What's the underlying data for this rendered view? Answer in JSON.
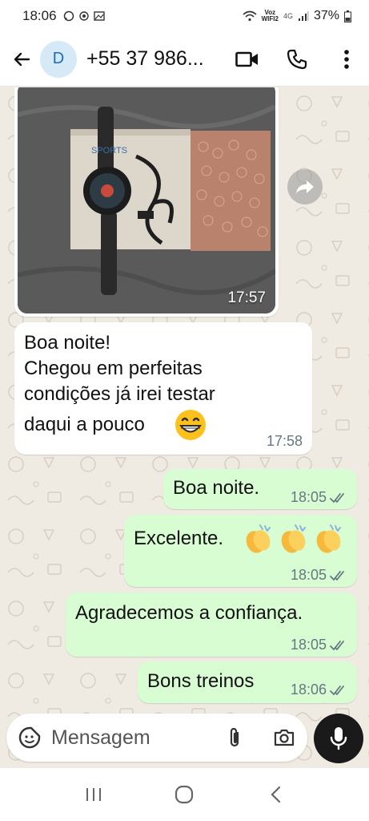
{
  "status_bar": {
    "time": "18:06",
    "voz_label": "Voz",
    "wifi_label": "WIFI2",
    "network": "4G",
    "battery": "37%"
  },
  "header": {
    "avatar_letter": "D",
    "contact": "+55 37 986..."
  },
  "messages": [
    {
      "id": "img",
      "type": "image",
      "time": "17:57",
      "box_text": "SPORTS"
    },
    {
      "id": "m1",
      "direction": "in",
      "lines": [
        "Boa noite!",
        "Chegou em perfeitas",
        "condições   já irei  testar",
        "daqui a pouco"
      ],
      "emoji": "grin-emoji",
      "time": "17:58"
    },
    {
      "id": "m2",
      "direction": "out",
      "text": "Boa noite.",
      "time": "18:05"
    },
    {
      "id": "m3",
      "direction": "out",
      "text": "Excelente.",
      "emoji": "clapping-hands-emoji",
      "emoji_count": 3,
      "time": "18:05"
    },
    {
      "id": "m4",
      "direction": "out",
      "text": "Agradecemos a confiança.",
      "time": "18:05"
    },
    {
      "id": "m5",
      "direction": "out",
      "text": "Bons treinos",
      "time": "18:06"
    }
  ],
  "composer": {
    "placeholder": "Mensagem"
  },
  "colors": {
    "outgoing": "#d9fdd3",
    "incoming": "#ffffff",
    "chat_bg": "#efeae2",
    "read_ticks": "#667781",
    "mic_button": "#1a1a1a"
  }
}
